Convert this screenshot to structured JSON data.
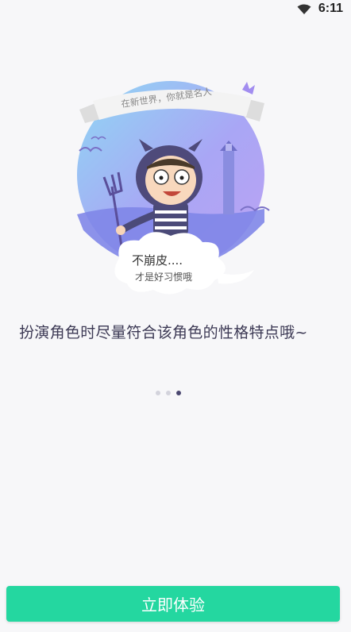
{
  "status_bar": {
    "time": "6:11",
    "wifi_icon": "wifi-icon"
  },
  "illustration": {
    "banner_text": "在新世界，你就是名人",
    "cloud_line1": "不崩皮....",
    "cloud_line2": "才是好习惯哦",
    "accent_color": "#a7a2ff"
  },
  "onboarding": {
    "caption": "扮演角色时尽量符合该角色的性格特点哦~",
    "page_count": 3,
    "active_page": 3
  },
  "cta": {
    "label": "立即体验",
    "color": "#24d7a0"
  }
}
